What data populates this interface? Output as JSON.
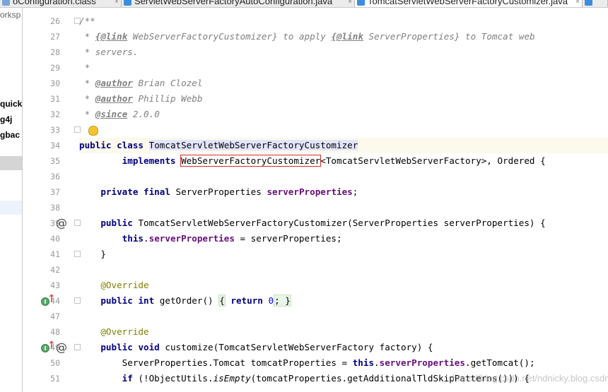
{
  "editor_tabs": [
    {
      "label": "oConfiguration.class",
      "icon": "class-file-icon",
      "close": "×",
      "active": false
    },
    {
      "label": "ServletWebServerFactoryAutoConfiguration.java",
      "icon": "java-class-icon",
      "close": "×",
      "active": false
    },
    {
      "label": "TomcatServletWebServerFactoryCustomizer.java",
      "icon": "java-class-icon",
      "close": "×",
      "active": true
    },
    {
      "label": "",
      "icon": "java-class-icon",
      "close": "",
      "active": false
    }
  ],
  "project_tree": {
    "items": [
      {
        "label": "orksp",
        "style": "dim"
      },
      {
        "label": "quick",
        "style": "bold"
      },
      {
        "label": "g4j",
        "style": "bold"
      },
      {
        "label": "gbac",
        "style": "bold"
      }
    ]
  },
  "colors": {
    "current_line": "#fcfaed",
    "class_name_highlight": "#e4e4ff",
    "selection_box": "#d62a2a",
    "selected_tree_row": "#d5d5d5",
    "cursor_tree_row": "#edf3fc"
  },
  "code": {
    "lines": [
      {
        "n": "26",
        "text": "/**"
      },
      {
        "n": "27",
        "text": " * {@link WebServerFactoryCustomizer} to apply {@link ServerProperties} to Tomcat web"
      },
      {
        "n": "28",
        "text": " * servers."
      },
      {
        "n": "29",
        "text": " *"
      },
      {
        "n": "30",
        "text": " * @author Brian Clozel"
      },
      {
        "n": "31",
        "text": " * @author Phillip Webb"
      },
      {
        "n": "32",
        "text": " * @since 2.0.0"
      },
      {
        "n": "33",
        "text": " */"
      },
      {
        "n": "34",
        "text": "public class TomcatServletWebServerFactoryCustomizer"
      },
      {
        "n": "35",
        "text": "        implements WebServerFactoryCustomizer<TomcatServletWebServerFactory>, Ordered {"
      },
      {
        "n": "36",
        "text": ""
      },
      {
        "n": "37",
        "text": "    private final ServerProperties serverProperties;"
      },
      {
        "n": "38",
        "text": ""
      },
      {
        "n": "39",
        "text": "    public TomcatServletWebServerFactoryCustomizer(ServerProperties serverProperties) {"
      },
      {
        "n": "40",
        "text": "        this.serverProperties = serverProperties;"
      },
      {
        "n": "41",
        "text": "    }"
      },
      {
        "n": "42",
        "text": ""
      },
      {
        "n": "43",
        "text": "    @Override"
      },
      {
        "n": "44",
        "text": "    public int getOrder() { return 0; }"
      },
      {
        "n": "47",
        "text": ""
      },
      {
        "n": "48",
        "text": "    @Override"
      },
      {
        "n": "49",
        "text": "    public void customize(TomcatServletWebServerFactory factory) {"
      },
      {
        "n": "50",
        "text": "        ServerProperties.Tomcat tomcatProperties = this.serverProperties.getTomcat();"
      },
      {
        "n": "51",
        "text": "        if (!ObjectUtils.isEmpty(tomcatProperties.getAdditionalTldSkipPatterns())) {"
      }
    ],
    "tokens": {
      "doc_open": "/**",
      "star": "*",
      "link_tag": "{@link",
      "link_cls1": "WebServerFactoryCustomizer}",
      "to_apply": "to apply",
      "link_cls2": "ServerProperties}",
      "to_tomcat_web": "to Tomcat web",
      "servers": "servers.",
      "author_tag": "@author",
      "author1": "Brian Clozel",
      "author2": "Phillip Webb",
      "since_tag": "@since",
      "since_val": "2.0.0",
      "kw_public": "public",
      "kw_class": "class",
      "cls_name": "TomcatServletWebServerFactoryCustomizer",
      "kw_implements": "implements",
      "iface": "WebServerFactoryCustomizer",
      "generic": "<TomcatServletWebServerFactory>, Ordered {",
      "kw_private": "private",
      "kw_final": "final",
      "type_sp": "ServerProperties",
      "fld_sp": "serverProperties",
      "semi": ";",
      "ctor_sig": "TomcatServletWebServerFactoryCustomizer(ServerProperties serverProperties) {",
      "kw_this": "this",
      "dot": ".",
      "assign": " = serverProperties;",
      "close_brace": "}",
      "override": "@Override",
      "kw_int": "int",
      "get_order": "getOrder()",
      "fold_open": "{",
      "kw_return": "return",
      "zero": "0",
      "fold_close": "; }",
      "kw_void": "void",
      "customize_sig": "customize(TomcatServletWebServerFactory factory) {",
      "tomcat_decl": "ServerProperties.Tomcat tomcatProperties = ",
      "get_tomcat": "getTomcat();",
      "kw_if": "if",
      "if_open": " (!ObjectUtils.",
      "is_empty": "isEmpty",
      "if_rest": "(tomcatProperties.getAdditionalTldSkipPatterns())) {"
    }
  },
  "watermark": "https://blog.csdn.net/ndnicky.blog.csdn.net"
}
